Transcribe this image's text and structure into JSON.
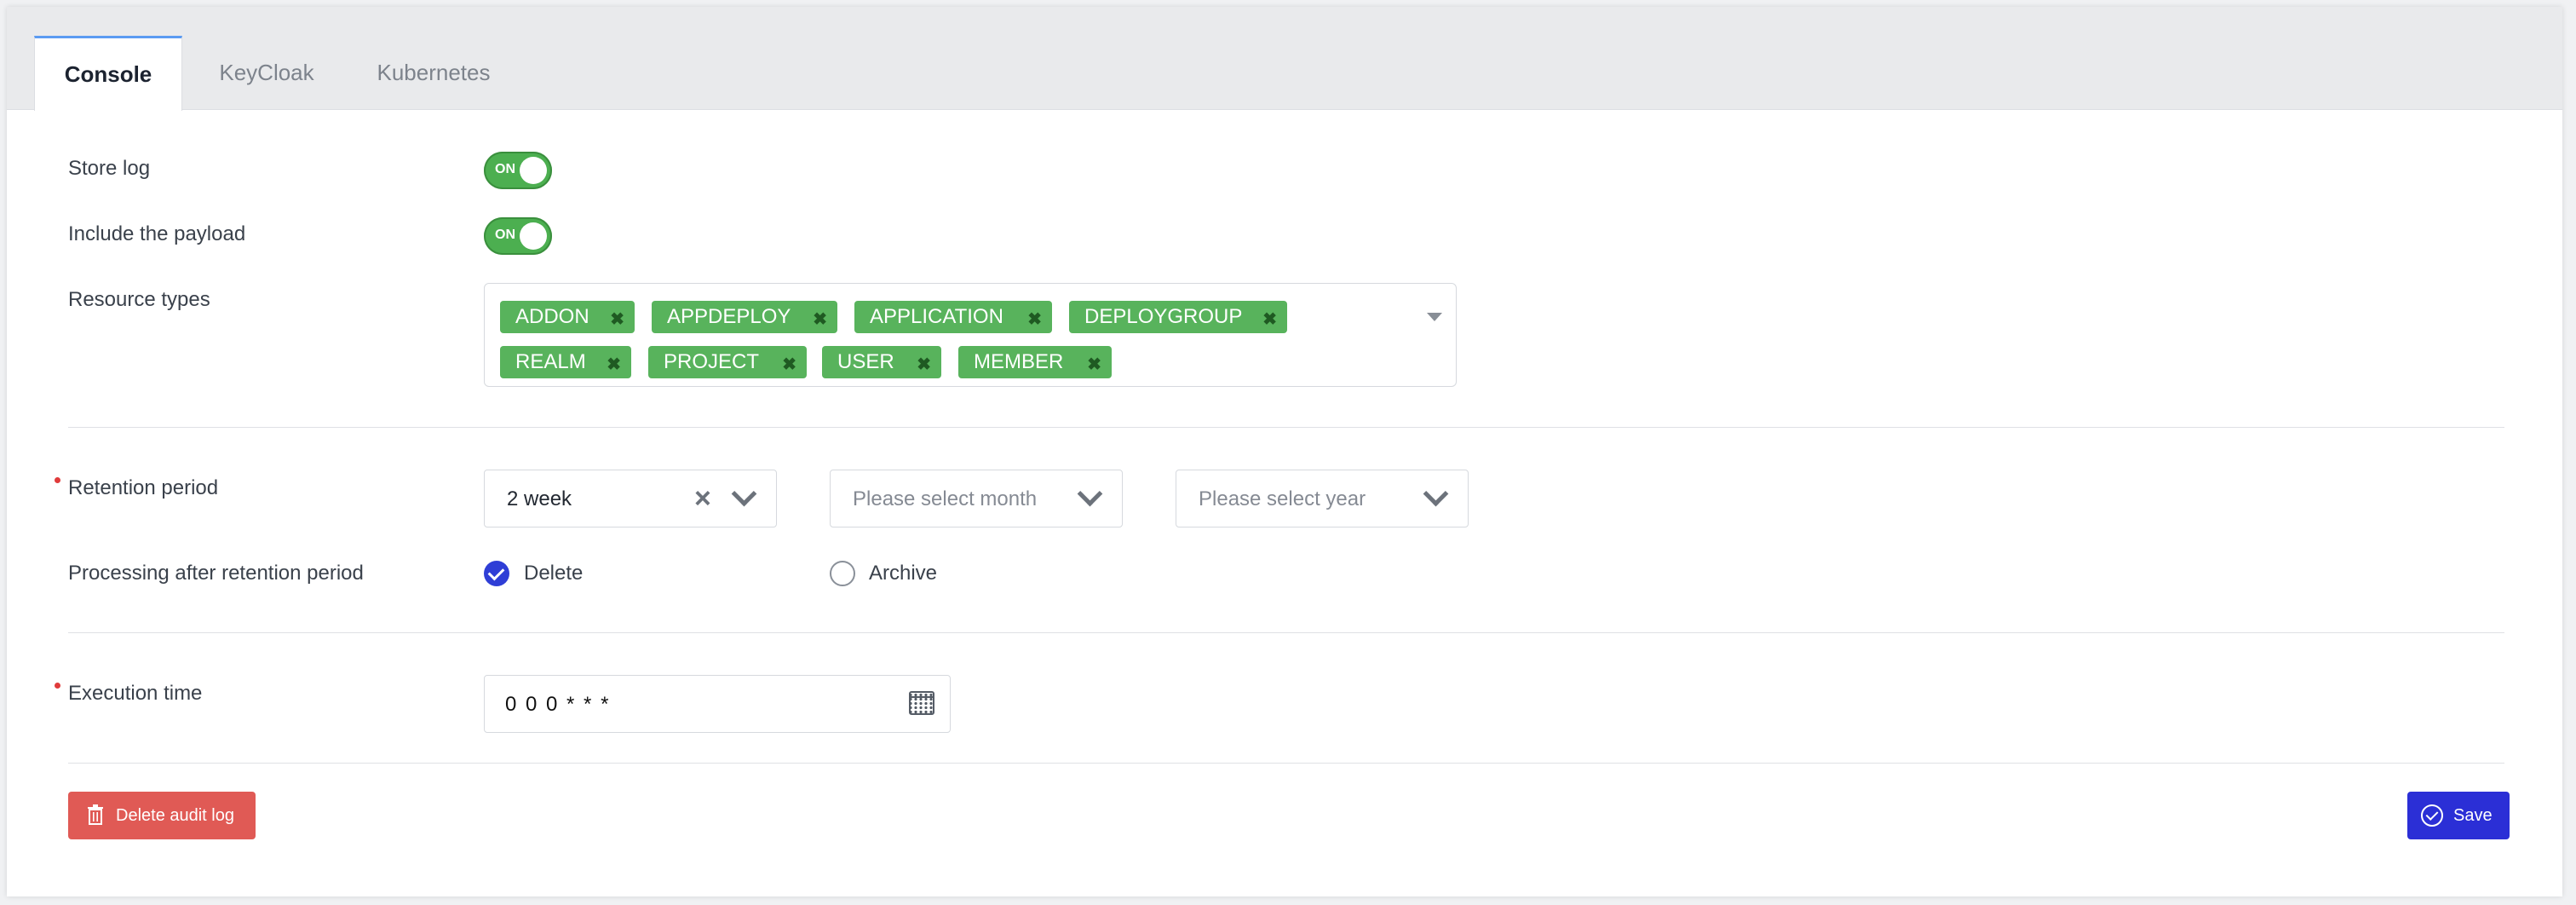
{
  "tabs": [
    {
      "label": "Console",
      "active": true
    },
    {
      "label": "KeyCloak",
      "active": false
    },
    {
      "label": "Kubernetes",
      "active": false
    }
  ],
  "form": {
    "store_log": {
      "label": "Store log",
      "toggle_text": "ON",
      "on": true
    },
    "include_payload": {
      "label": "Include the payload",
      "toggle_text": "ON",
      "on": true
    },
    "resource_types": {
      "label": "Resource types",
      "tags": [
        "ADDON",
        "APPDEPLOY",
        "APPLICATION",
        "DEPLOYGROUP",
        "REALM",
        "PROJECT",
        "USER",
        "MEMBER"
      ],
      "remove_glyph": "✖"
    },
    "retention_period": {
      "label": "Retention period",
      "required": true,
      "week_value": "2 week",
      "month_placeholder": "Please select month",
      "year_placeholder": "Please select year"
    },
    "processing": {
      "label": "Processing after retention period",
      "options": [
        {
          "label": "Delete",
          "selected": true
        },
        {
          "label": "Archive",
          "selected": false
        }
      ]
    },
    "execution_time": {
      "label": "Execution time",
      "required": true,
      "value": "0 0 0 * * *"
    }
  },
  "actions": {
    "delete_label": "Delete audit log",
    "save_label": "Save"
  },
  "colors": {
    "toggle_on": "#4caf50",
    "tag_bg": "#58b35c",
    "danger": "#e05a55",
    "primary": "#2b2fd6",
    "active_tab_border": "#5b9bf2",
    "required": "#e03b3b"
  },
  "icons": {
    "tag_remove": "close-icon",
    "dropdown": "caret-down-icon",
    "select_clear": "clear-icon",
    "select_arrow": "chevron-down-icon",
    "calendar": "calendar-icon",
    "delete": "trash-icon",
    "save": "check-circle-icon",
    "radio_selected": "check-icon"
  }
}
